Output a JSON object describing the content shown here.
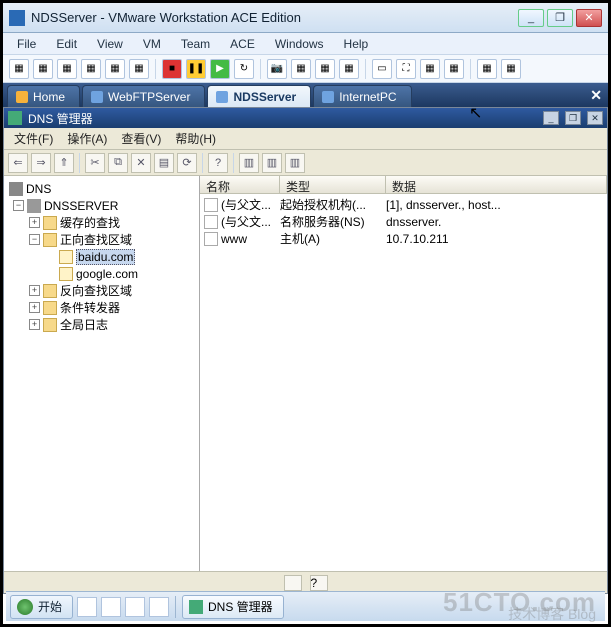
{
  "window": {
    "title": "NDSServer - VMware Workstation ACE Edition",
    "min": "_",
    "max": "❐",
    "close": "✕"
  },
  "menu": {
    "file": "File",
    "edit": "Edit",
    "view": "View",
    "vm": "VM",
    "team": "Team",
    "ace": "ACE",
    "windows": "Windows",
    "help": "Help"
  },
  "tabs": {
    "home": "Home",
    "webftp": "WebFTPServer",
    "nds": "NDSServer",
    "inet": "InternetPC",
    "close": "✕"
  },
  "inner": {
    "title": "DNS 管理器",
    "menu": {
      "file": "文件(F)",
      "action": "操作(A)",
      "view": "查看(V)",
      "help": "帮助(H)"
    },
    "min": "_",
    "restore": "❐",
    "close": "✕"
  },
  "tree": {
    "root": "DNS",
    "server": "DNSSERVER",
    "cache": "缓存的查找",
    "fwd": "正向查找区域",
    "baidu": "baidu.com",
    "google": "google.com",
    "rev": "反向查找区域",
    "cond": "条件转发器",
    "log": "全局日志"
  },
  "list": {
    "headers": {
      "name": "名称",
      "type": "类型",
      "data": "数据"
    },
    "rows": [
      {
        "name": "(与父文...",
        "type": "起始授权机构(...",
        "data": "[1], dnsserver., host..."
      },
      {
        "name": "(与父文...",
        "type": "名称服务器(NS)",
        "data": "dnsserver."
      },
      {
        "name": "www",
        "type": "主机(A)",
        "data": "10.7.10.211"
      }
    ]
  },
  "taskbar": {
    "start": "开始",
    "task": "DNS 管理器"
  },
  "watermark": {
    "main": "51CTO.com",
    "sub": "技术博客  Blog"
  }
}
